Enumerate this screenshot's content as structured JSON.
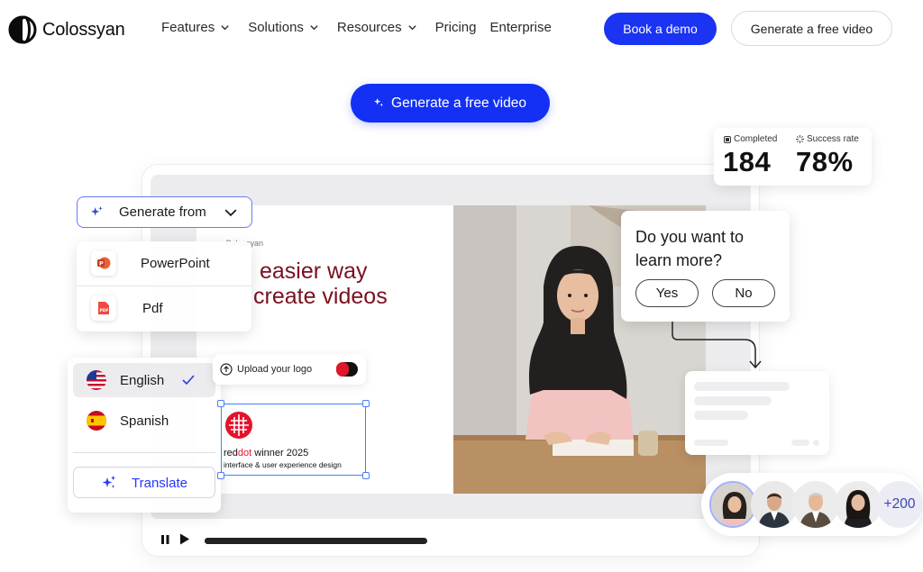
{
  "brand": {
    "name": "Colossyan"
  },
  "nav": {
    "items": [
      {
        "label": "Features",
        "has_dropdown": true
      },
      {
        "label": "Solutions",
        "has_dropdown": true
      },
      {
        "label": "Resources",
        "has_dropdown": true
      },
      {
        "label": "Pricing",
        "has_dropdown": false
      },
      {
        "label": "Enterprise",
        "has_dropdown": false
      }
    ],
    "book_demo": "Book a demo",
    "free_video": "Generate a free video"
  },
  "hero": {
    "cta": "Generate a free video"
  },
  "stats": {
    "completed_label": "Completed",
    "completed_value": "184",
    "success_label": "Success rate",
    "success_value": "78%"
  },
  "generate": {
    "label": "Generate from",
    "sources": [
      {
        "label": "PowerPoint",
        "icon": "powerpoint-icon"
      },
      {
        "label": "Pdf",
        "icon": "pdf-icon"
      }
    ]
  },
  "slide": {
    "brand": "Colossyan",
    "line1": "easier way",
    "line2": "create videos"
  },
  "upload": {
    "label": "Upload your logo"
  },
  "award": {
    "red": "red",
    "dot": "dot",
    "winner": " winner 2025",
    "subtitle": "interface & user experience design"
  },
  "languages": {
    "items": [
      {
        "label": "English",
        "selected": true
      },
      {
        "label": "Spanish",
        "selected": false
      }
    ],
    "translate": "Translate"
  },
  "question": {
    "text": "Do you want to learn more?",
    "yes": "Yes",
    "no": "No"
  },
  "avatars": {
    "more": "+200"
  },
  "player": {
    "progress": 0.38
  },
  "colors": {
    "primary": "#1b33f2",
    "accent_text": "#2438ff",
    "slide_text": "#7a1020"
  }
}
